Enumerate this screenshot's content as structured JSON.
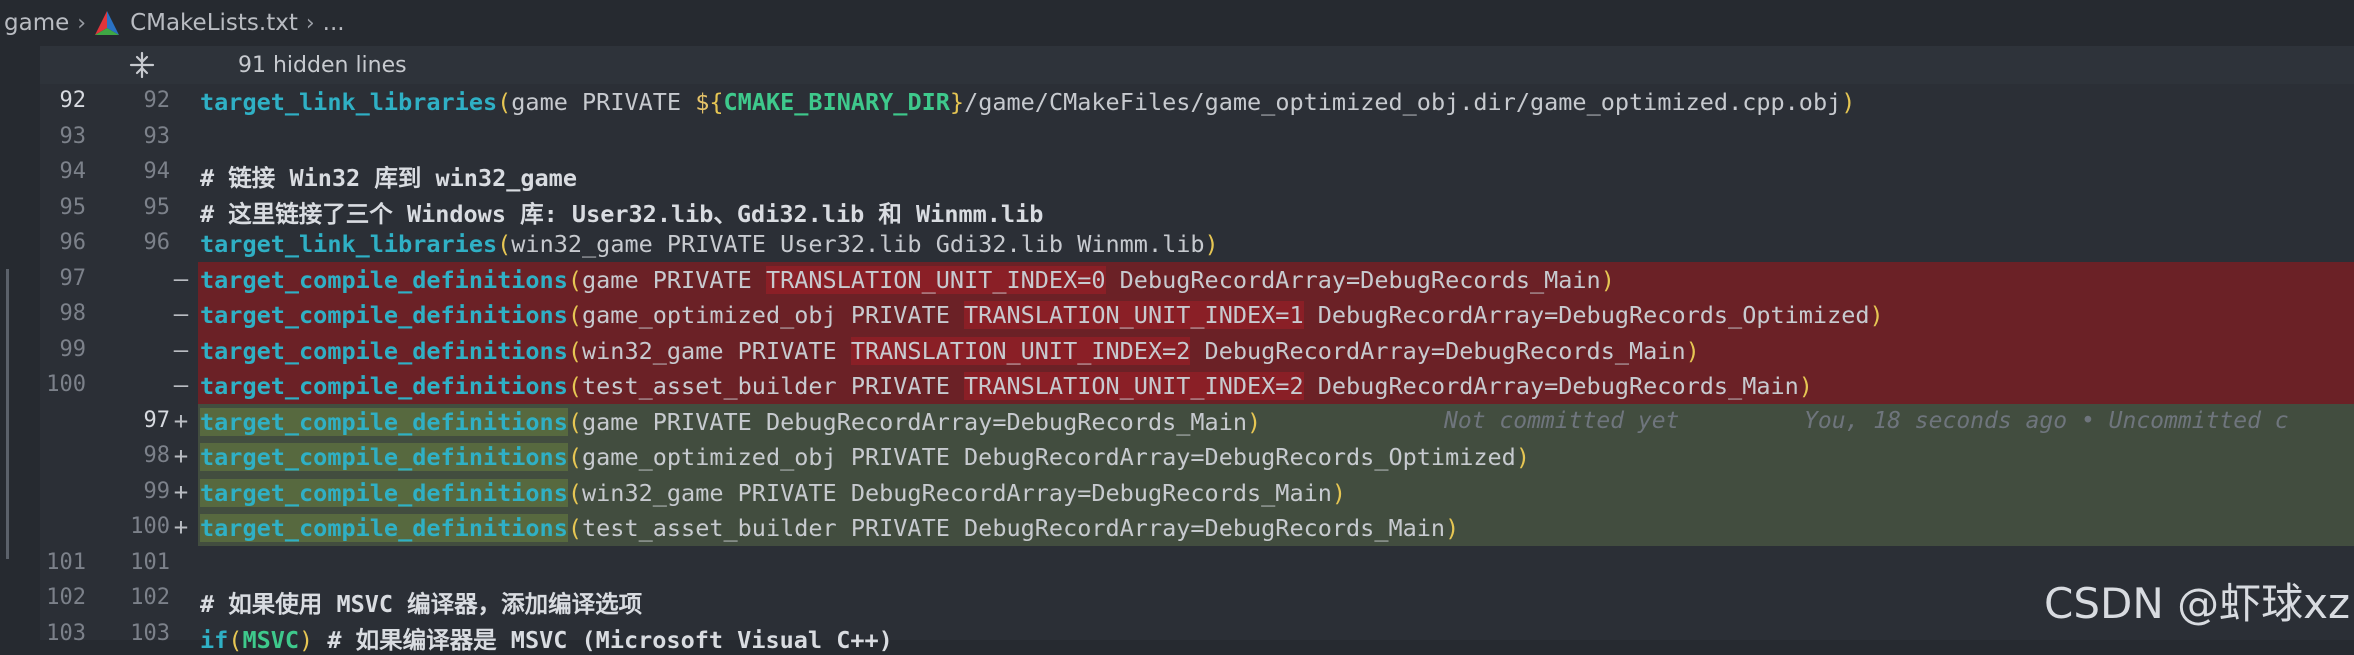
{
  "breadcrumb": {
    "folder": "game",
    "file": "CMakeLists.txt",
    "rest": "..."
  },
  "hidden": {
    "text": "91 hidden lines"
  },
  "lines": [
    {
      "old": "92",
      "new": "92",
      "type": "ctx",
      "current": true
    },
    {
      "old": "93",
      "new": "93",
      "type": "ctx"
    },
    {
      "old": "94",
      "new": "94",
      "type": "ctx"
    },
    {
      "old": "95",
      "new": "95",
      "type": "ctx"
    },
    {
      "old": "96",
      "new": "96",
      "type": "ctx"
    },
    {
      "old": "97",
      "new": "",
      "type": "del",
      "marker": "—"
    },
    {
      "old": "98",
      "new": "",
      "type": "del",
      "marker": "—"
    },
    {
      "old": "99",
      "new": "",
      "type": "del",
      "marker": "—"
    },
    {
      "old": "100",
      "new": "",
      "type": "del",
      "marker": "—"
    },
    {
      "old": "",
      "new": "97",
      "type": "add",
      "marker": "+",
      "current": true
    },
    {
      "old": "",
      "new": "98",
      "type": "add",
      "marker": "+"
    },
    {
      "old": "",
      "new": "99",
      "type": "add",
      "marker": "+"
    },
    {
      "old": "",
      "new": "100",
      "type": "add",
      "marker": "+"
    },
    {
      "old": "101",
      "new": "101",
      "type": "ctx"
    },
    {
      "old": "102",
      "new": "102",
      "type": "ctx"
    },
    {
      "old": "103",
      "new": "103",
      "type": "ctx"
    }
  ],
  "code": {
    "l92": {
      "fn": "target_link_libraries",
      "a": "game PRIVATE ",
      "d": "$",
      "var": "CMAKE_BINARY_DIR",
      "b": "/game/CMakeFiles/game_optimized_obj.dir/game_optimized.cpp.obj"
    },
    "l94": "# 链接 Win32 库到 win32_game",
    "l95": "# 这里链接了三个 Windows 库: User32.lib、Gdi32.lib 和 Winmm.lib",
    "l96": {
      "fn": "target_link_libraries",
      "a": "win32_game PRIVATE User32.lib Gdi32.lib Winmm.lib"
    },
    "d97": {
      "fn": "target_compile_definitions",
      "a": "game PRIVATE ",
      "h": "TRANSLATION_UNIT_INDEX=0",
      "b": " DebugRecordArray=DebugRecords_Main"
    },
    "d98": {
      "fn": "target_compile_definitions",
      "a": "game_optimized_obj PRIVATE ",
      "h": "TRANSLATION_UNIT_INDEX=1",
      "b": " DebugRecordArray=DebugRecords_Optimized"
    },
    "d99": {
      "fn": "target_compile_definitions",
      "a": "win32_game PRIVATE ",
      "h": "TRANSLATION_UNIT_INDEX=2",
      "b": " DebugRecordArray=DebugRecords_Main"
    },
    "d100": {
      "fn": "target_compile_definitions",
      "a": "test_asset_builder PRIVATE ",
      "h": "TRANSLATION_UNIT_INDEX=2",
      "b": " DebugRecordArray=DebugRecords_Main"
    },
    "a97": {
      "fn": "target_compile_definitions",
      "a": "game PRIVATE ",
      "b": "DebugRecordArray=DebugRecords_Main"
    },
    "a98": {
      "fn": "target_compile_definitions",
      "a": "game_optimized_obj PRIVATE ",
      "b": "DebugRecordArray=DebugRecords_Optimized"
    },
    "a99": {
      "fn": "target_compile_definitions",
      "a": "win32_game PRIVATE ",
      "b": "DebugRecordArray=DebugRecords_Main"
    },
    "a100": {
      "fn": "target_compile_definitions",
      "a": "test_asset_builder PRIVATE ",
      "b": "DebugRecordArray=DebugRecords_Main"
    },
    "l102": "# 如果使用 MSVC 编译器，添加编译选项",
    "l103": {
      "fn": "if",
      "a": "MSVC",
      "c": " # 如果编译器是 MSVC (Microsoft Visual C++)"
    }
  },
  "blame": {
    "status": "Not committed yet",
    "detail": "You, 18 seconds ago • Uncommitted c"
  },
  "watermark": "CSDN @虾球xz",
  "colors": {
    "deleted_bg": "#6b2126",
    "added_bg": "#424d3f",
    "function": "#2fb0c5",
    "variable": "#3ec98c"
  }
}
